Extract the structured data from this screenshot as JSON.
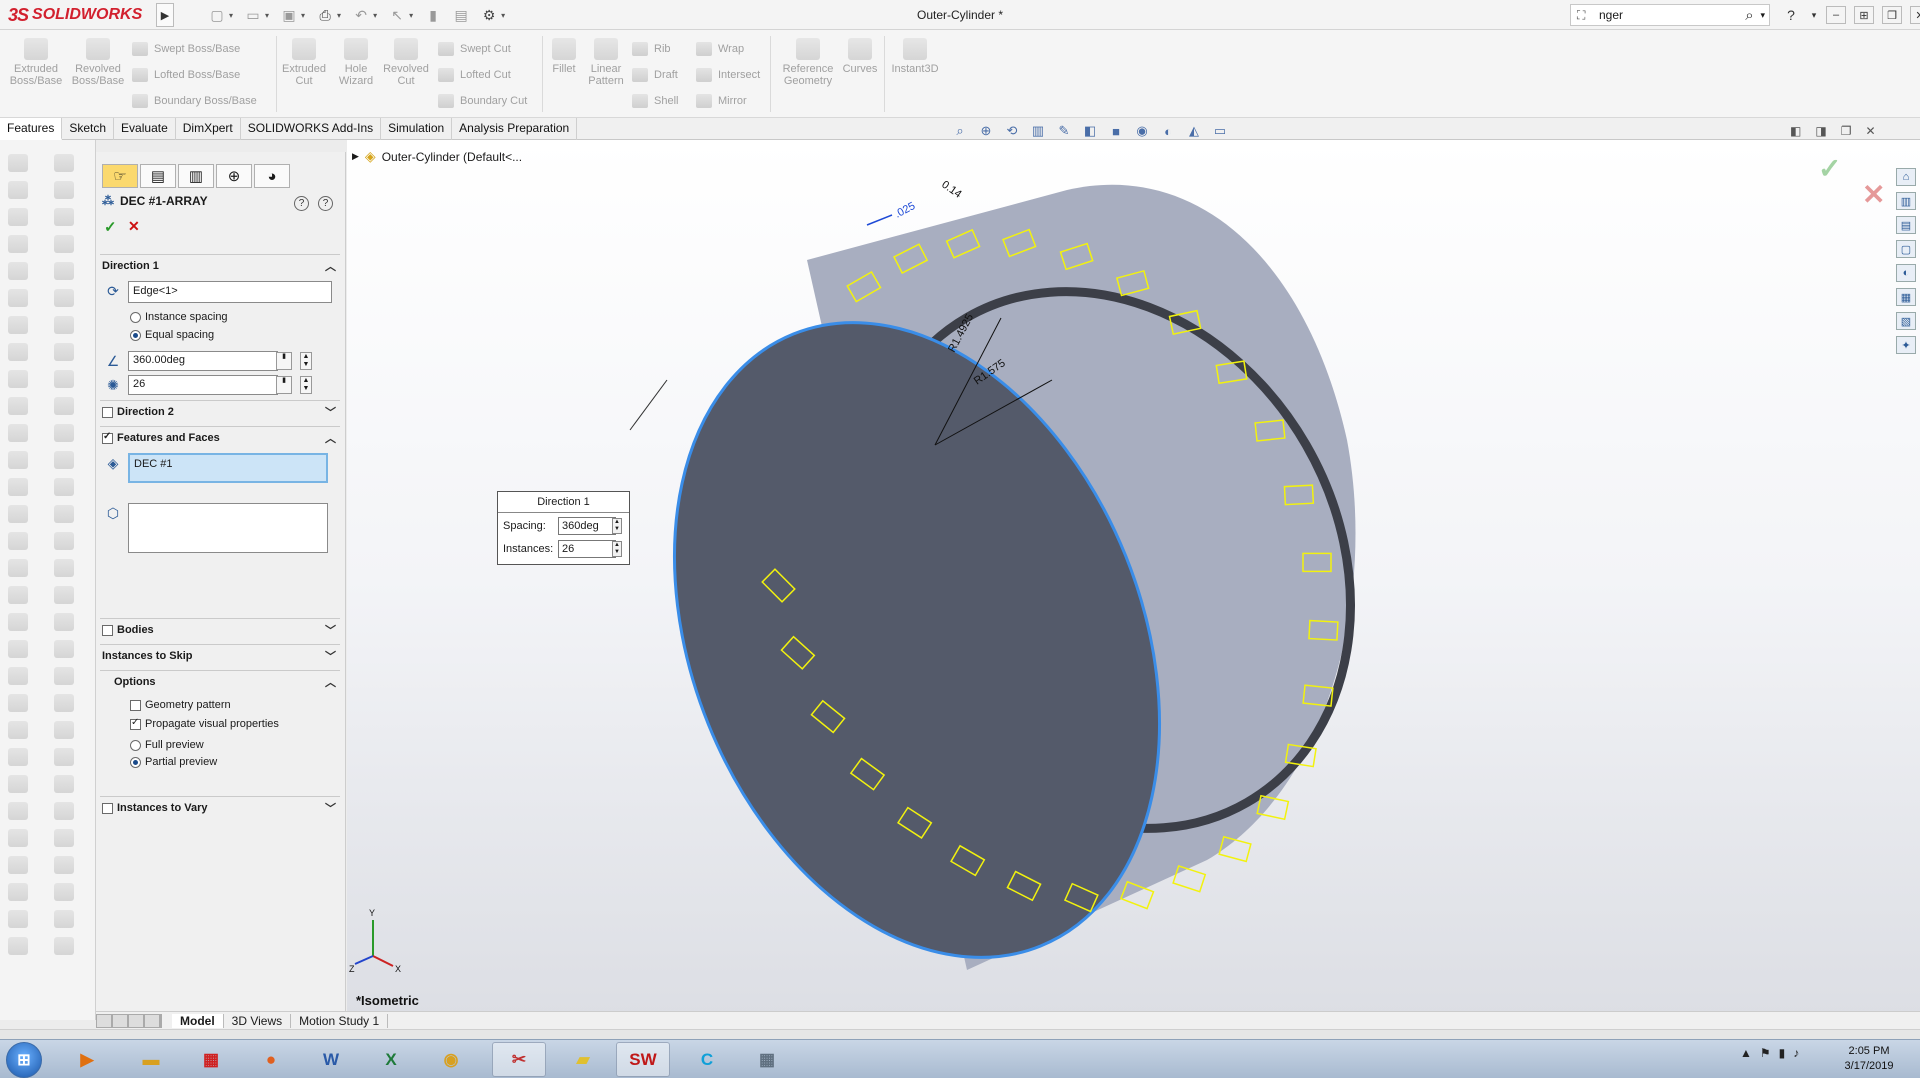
{
  "app": {
    "brand": "SOLIDWORKS",
    "brand_prefix": "3S",
    "document_title": "Outer-Cylinder *"
  },
  "search": {
    "value": "nger"
  },
  "command_manager": {
    "big": [
      {
        "label": "Extruded Boss/Base"
      },
      {
        "label": "Revolved Boss/Base"
      },
      {
        "label": "Extruded Cut"
      },
      {
        "label": "Hole Wizard"
      },
      {
        "label": "Revolved Cut"
      },
      {
        "label": "Fillet"
      },
      {
        "label": "Linear Pattern"
      },
      {
        "label": "Reference Geometry"
      },
      {
        "label": "Curves"
      },
      {
        "label": "Instant3D"
      }
    ],
    "small": [
      {
        "label": "Swept Boss/Base"
      },
      {
        "label": "Lofted Boss/Base"
      },
      {
        "label": "Boundary Boss/Base"
      },
      {
        "label": "Swept Cut"
      },
      {
        "label": "Lofted Cut"
      },
      {
        "label": "Boundary Cut"
      },
      {
        "label": "Rib"
      },
      {
        "label": "Draft"
      },
      {
        "label": "Shell"
      },
      {
        "label": "Wrap"
      },
      {
        "label": "Intersect"
      },
      {
        "label": "Mirror"
      }
    ]
  },
  "tabs": [
    "Features",
    "Sketch",
    "Evaluate",
    "DimXpert",
    "SOLIDWORKS Add-Ins",
    "Simulation",
    "Analysis Preparation"
  ],
  "property_manager": {
    "title": "DEC #1-ARRAY",
    "direction1": {
      "header": "Direction 1",
      "edge": "Edge<1>",
      "instance_spacing": "Instance spacing",
      "equal_spacing": "Equal spacing",
      "angle": "360.00deg",
      "count": "26"
    },
    "direction2": {
      "header": "Direction 2"
    },
    "features_faces": {
      "header": "Features and Faces",
      "selected": "DEC #1"
    },
    "bodies": {
      "header": "Bodies"
    },
    "skip": {
      "header": "Instances to Skip"
    },
    "options": {
      "header": "Options",
      "geometry_pattern": "Geometry pattern",
      "propagate": "Propagate visual properties",
      "full_preview": "Full preview",
      "partial_preview": "Partial preview"
    },
    "vary": {
      "header": "Instances to Vary"
    }
  },
  "feature_tree": {
    "root": "Outer-Cylinder  (Default<..."
  },
  "callout": {
    "title": "Direction 1",
    "spacing_label": "Spacing:",
    "spacing_value": "360deg",
    "instances_label": "Instances:",
    "instances_value": "26"
  },
  "dimensions": {
    "d1": "0.14",
    "d2": ".025",
    "d3": "R1.4925",
    "d4": "R1.575"
  },
  "view": {
    "name": "*Isometric",
    "triad_y": "Y",
    "triad_x": "X",
    "triad_z": "Z"
  },
  "bottom_tabs": [
    "Model",
    "3D Views",
    "Motion Study 1"
  ],
  "taskbar": {
    "time": "2:05 PM",
    "date": "3/17/2019",
    "apps": [
      "Media",
      "Explorer",
      "Apps",
      "Firefox",
      "Word",
      "Excel",
      "Chrome",
      "Snipping",
      "Notes",
      "SW",
      "C",
      "Calc"
    ]
  },
  "colors": {
    "accent": "#1e64c8",
    "pattern_yellow": "#f2f20e",
    "body_grey": "#545a6a",
    "rim_grey": "#9aa0b4"
  }
}
